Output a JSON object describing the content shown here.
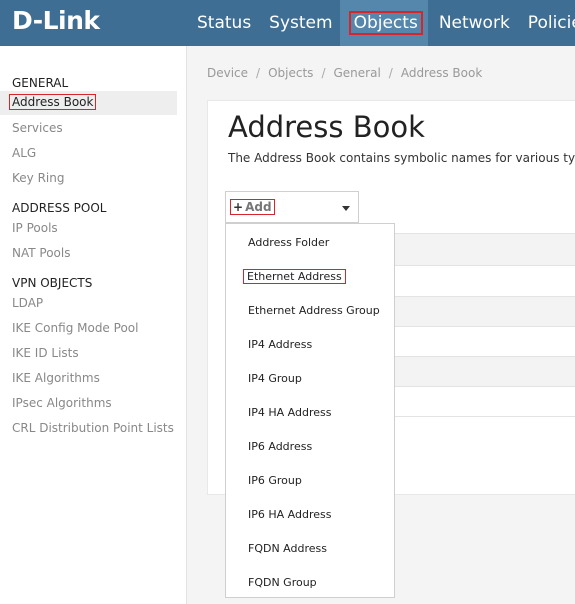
{
  "header": {
    "logo": "D-Link",
    "nav": [
      "Status",
      "System",
      "Objects",
      "Network",
      "Policies"
    ],
    "active_nav": "Objects"
  },
  "sidebar": {
    "sections": [
      {
        "title": "GENERAL",
        "items": [
          "Address Book",
          "Services",
          "ALG",
          "Key Ring"
        ]
      },
      {
        "title": "ADDRESS POOL",
        "items": [
          "IP Pools",
          "NAT Pools"
        ]
      },
      {
        "title": "VPN OBJECTS",
        "items": [
          "LDAP",
          "IKE Config Mode Pool",
          "IKE ID Lists",
          "IKE Algorithms",
          "IPsec Algorithms",
          "CRL Distribution Point Lists"
        ]
      }
    ],
    "active_item": "Address Book"
  },
  "breadcrumb": [
    "Device",
    "Objects",
    "General",
    "Address Book"
  ],
  "main": {
    "title": "Address Book",
    "description": "The Address Book contains symbolic names for various typ",
    "add_button": {
      "icon": "plus-icon",
      "label": "Add"
    }
  },
  "dropdown": {
    "items": [
      "Address Folder",
      "Ethernet Address",
      "Ethernet Address Group",
      "IP4 Address",
      "IP4 Group",
      "IP4 HA Address",
      "IP6 Address",
      "IP6 Group",
      "IP6 HA Address",
      "FQDN Address",
      "FQDN Group"
    ],
    "highlighted": "Ethernet Address"
  },
  "colors": {
    "topbar": "#3e6e93",
    "topbar_active": "#5586ab",
    "highlight_border": "#d9252a"
  }
}
